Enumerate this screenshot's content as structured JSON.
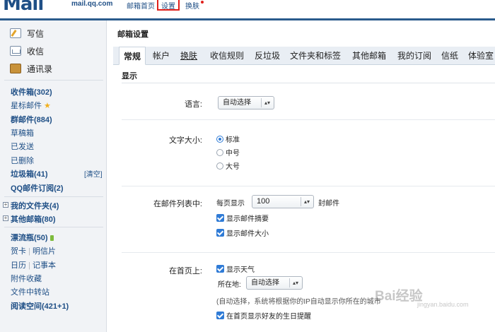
{
  "header": {
    "logo_text": "Mail",
    "logo_domain": "mail.qq.com",
    "nav": {
      "home": "邮箱首页",
      "settings": "设置",
      "skin": "换肤"
    }
  },
  "sidebar": {
    "actions": {
      "write": "写信",
      "inbox_action": "收信",
      "contacts": "通讯录"
    },
    "folders": {
      "inbox": "收件箱(302)",
      "starred": "星标邮件",
      "group": "群邮件(884)",
      "drafts": "草稿箱",
      "sent": "已发送",
      "deleted": "已删除",
      "spam": "垃圾箱(41)",
      "spam_clear": "[清空]",
      "qq_subscription": "QQ邮件订阅(2)"
    },
    "my_folders": "我的文件夹(4)",
    "other_mailboxes": "其他邮箱(80)",
    "extras": {
      "drift_bottle": "漂流瓶(50)",
      "card": "贺卡",
      "postcard": "明信片",
      "calendar": "日历",
      "notes": "记事本",
      "attachments": "附件收藏",
      "file_transfer": "文件中转站",
      "reading": "阅读空间(421+1)"
    }
  },
  "main": {
    "title": "邮箱设置",
    "tabs": [
      "常规",
      "帐户",
      "换肤",
      "收信规则",
      "反垃圾",
      "文件夹和标签",
      "其他邮箱",
      "我的订阅",
      "信纸",
      "体验室"
    ],
    "section_title": "显示",
    "language": {
      "label": "语言:",
      "value": "自动选择"
    },
    "font_size": {
      "label": "文字大小:",
      "options": [
        "标准",
        "中号",
        "大号"
      ],
      "selected": "标准"
    },
    "mail_list": {
      "label": "在邮件列表中:",
      "per_page_prefix": "每页显示",
      "per_page_value": "100",
      "per_page_suffix": "封邮件",
      "show_summary": "显示邮件摘要",
      "show_size": "显示邮件大小"
    },
    "homepage": {
      "label": "在首页上:",
      "show_weather": "显示天气",
      "location_label": "所在地:",
      "location_value": "自动选择",
      "auto_note": "(自动选择，系统将根据你的IP自动显示你所在的城市",
      "show_birthday": "在首页显示好友的生日提醒"
    }
  },
  "watermark": {
    "main": "Bai经验",
    "sub": "jingyan.baidu.com"
  }
}
